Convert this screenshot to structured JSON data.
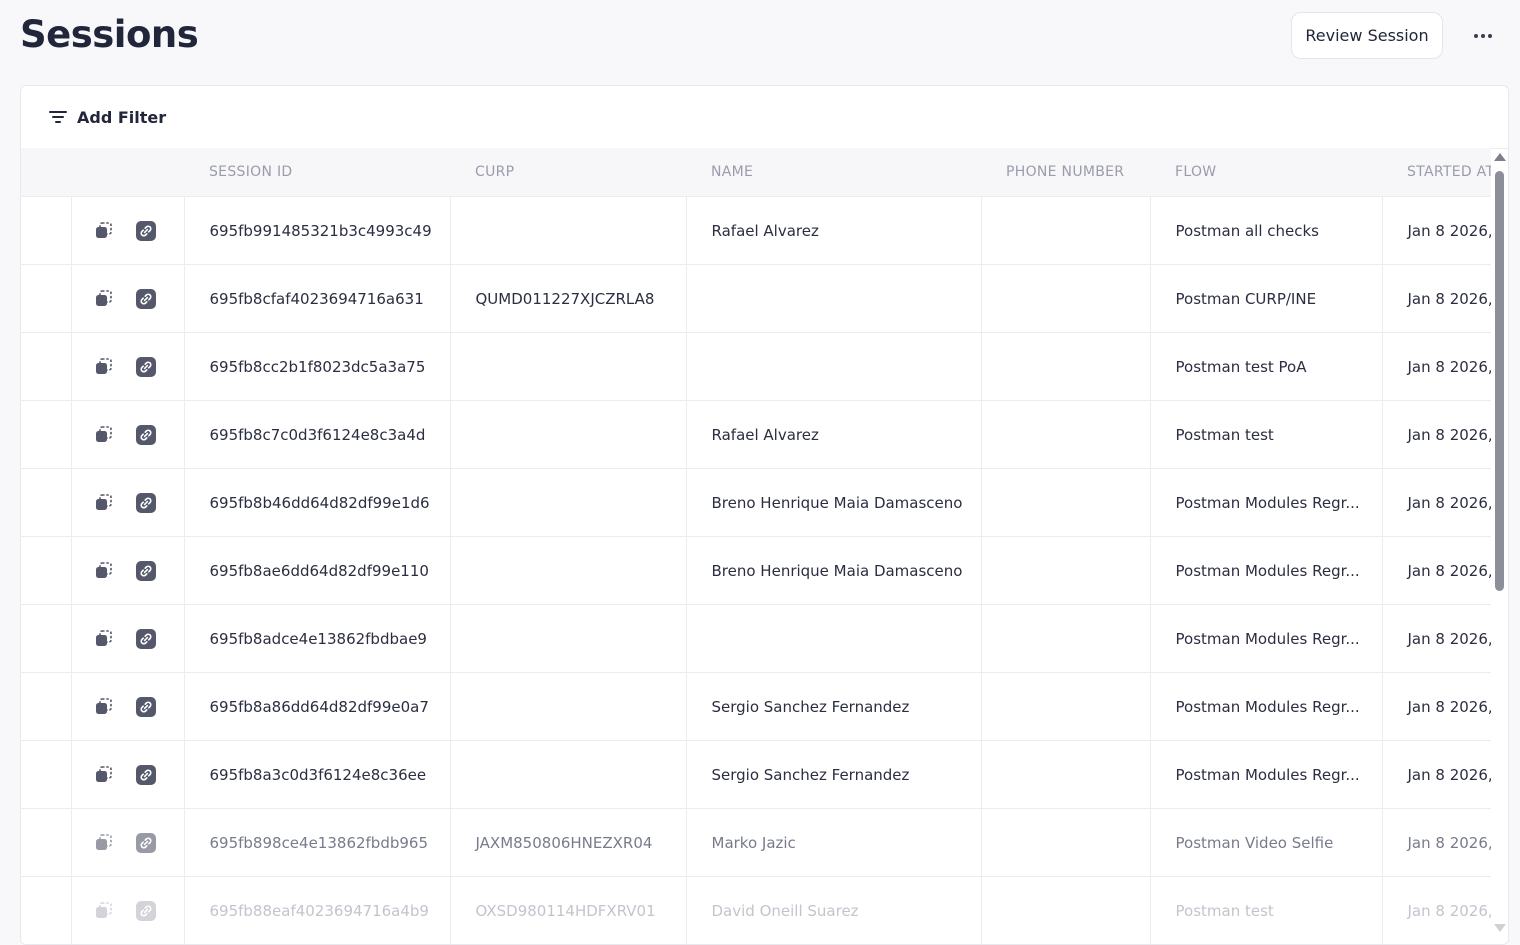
{
  "page": {
    "title": "Sessions"
  },
  "toolbar": {
    "review_label": "Review Session",
    "more_icon": "more-horizontal-icon"
  },
  "filter": {
    "label": "Add Filter",
    "icon": "filter-icon"
  },
  "table": {
    "headers": [
      "SESSION ID",
      "CURP",
      "NAME",
      "PHONE NUMBER",
      "FLOW",
      "STARTED AT"
    ],
    "rows": [
      {
        "session_id": "695fb991485321b3c4993c49",
        "curp": "",
        "name": "Rafael Alvarez",
        "phone": "",
        "flow": "Postman all checks",
        "started": "Jan 8 2026,"
      },
      {
        "session_id": "695fb8cfaf4023694716a631",
        "curp": "QUMD011227XJCZRLA8",
        "name": "",
        "phone": "",
        "flow": "Postman CURP/INE",
        "started": "Jan 8 2026,"
      },
      {
        "session_id": "695fb8cc2b1f8023dc5a3a75",
        "curp": "",
        "name": "",
        "phone": "",
        "flow": "Postman test PoA",
        "started": "Jan 8 2026,"
      },
      {
        "session_id": "695fb8c7c0d3f6124e8c3a4d",
        "curp": "",
        "name": "Rafael Alvarez",
        "phone": "",
        "flow": "Postman test",
        "started": "Jan 8 2026,"
      },
      {
        "session_id": "695fb8b46dd64d82df99e1d6",
        "curp": "",
        "name": "Breno Henrique Maia Damasceno",
        "phone": "",
        "flow": "Postman Modules Regr...",
        "started": "Jan 8 2026,"
      },
      {
        "session_id": "695fb8ae6dd64d82df99e110",
        "curp": "",
        "name": "Breno Henrique Maia Damasceno",
        "phone": "",
        "flow": "Postman Modules Regr...",
        "started": "Jan 8 2026,"
      },
      {
        "session_id": "695fb8adce4e13862fbdbae9",
        "curp": "",
        "name": "",
        "phone": "",
        "flow": "Postman Modules Regr...",
        "started": "Jan 8 2026,"
      },
      {
        "session_id": "695fb8a86dd64d82df99e0a7",
        "curp": "",
        "name": "Sergio Sanchez Fernandez",
        "phone": "",
        "flow": "Postman Modules Regr...",
        "started": "Jan 8 2026,"
      },
      {
        "session_id": "695fb8a3c0d3f6124e8c36ee",
        "curp": "",
        "name": "Sergio Sanchez Fernandez",
        "phone": "",
        "flow": "Postman Modules Regr...",
        "started": "Jan 8 2026,"
      },
      {
        "session_id": "695fb898ce4e13862fbdb965",
        "curp": "JAXM850806HNEZXR04",
        "name": "Marko Jazic",
        "phone": "",
        "flow": "Postman Video Selfie",
        "started": "Jan 8 2026,"
      },
      {
        "session_id": "695fb88eaf4023694716a4b9",
        "curp": "OXSD980114HDFXRV01",
        "name": "David Oneill Suarez",
        "phone": "",
        "flow": "Postman test",
        "started": "Jan 8 2026,"
      }
    ]
  }
}
